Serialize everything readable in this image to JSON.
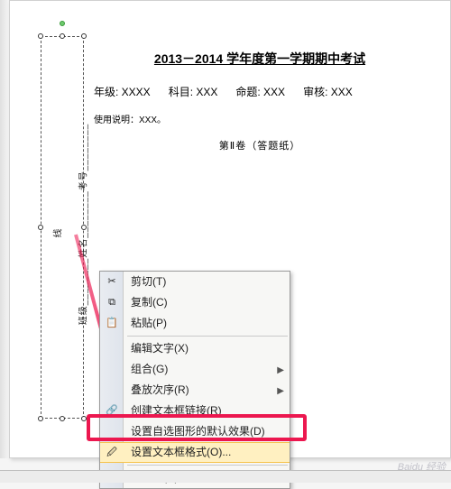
{
  "doc": {
    "title": "2013－2014 学年度第一学期期中考试",
    "grade_label": "年级: XXXX",
    "subject_label": "科目: XXX",
    "setter_label": "命题: XXX",
    "reviewer_label": "审核: XXX",
    "instruction": "使用说明：XXX。",
    "section": "第Ⅱ卷（答题纸）"
  },
  "vertical_labels": "班级________姓名________考号________",
  "side_line_text": "线",
  "menu": {
    "cut": "剪切(T)",
    "copy": "复制(C)",
    "paste": "粘贴(P)",
    "edit_text": "编辑文字(X)",
    "group": "组合(G)",
    "order": "叠放次序(R)",
    "create_link": "创建文本框链接(R)",
    "set_default": "设置自选图形的默认效果(D)",
    "format_textbox": "设置文本框格式(O)...",
    "hyperlink": "超链接(H)..."
  },
  "watermark": "Baidu 经验"
}
